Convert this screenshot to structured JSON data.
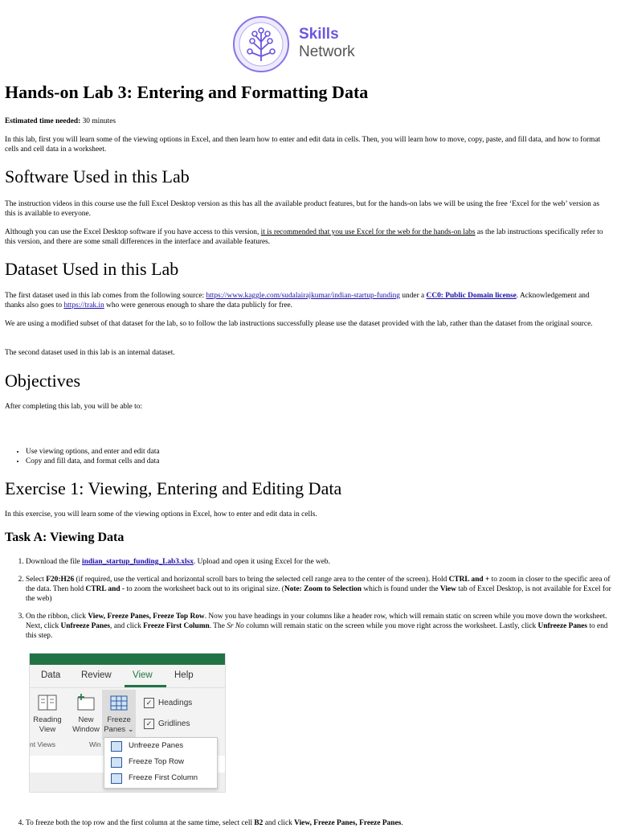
{
  "header": {
    "logo_word1": "Skills",
    "logo_word2": "Network"
  },
  "title": "Hands-on Lab 3: Entering and Formatting Data",
  "estimated": {
    "label": "Estimated time needed:",
    "value": "30 minutes"
  },
  "intro": "In this lab, first you will learn some of the viewing options in Excel, and then learn how to enter and edit data in cells. Then, you will learn how to move, copy, paste, and fill data, and how to format cells and cell data in a worksheet.",
  "software": {
    "heading": "Software Used in this Lab",
    "p1": "The instruction videos in this course use the full Excel Desktop version as this has all the available product features, but for the hands-on labs we will be using the free ‘Excel for the web’ version as this is available to everyone.",
    "p2_a": "Although you can use the Excel Desktop software if you have access to this version, ",
    "p2_u": "it is recommended that you use Excel for the web for the hands-on labs",
    "p2_b": " as the lab instructions specifically refer to this version, and there are some small differences in the interface and available features."
  },
  "dataset": {
    "heading": "Dataset Used in this Lab",
    "p1_a": "The first dataset used in this lab comes from the following source: ",
    "link1": "https://www.kaggle.com/sudalairajkumar/indian-startup-funding",
    "p1_b": " under a ",
    "link2": "CC0: Public Domain license",
    "p1_c": ". Acknowledgement and thanks also goes to ",
    "link3": "https://trak.in",
    "p1_d": " who were generous enough to share the data publicly for free.",
    "p2": "We are using a modified subset of that dataset for the lab, so to follow the lab instructions successfully please use the dataset provided with the lab, rather than the dataset from the original source.",
    "p3": "The second dataset used in this lab is an internal dataset."
  },
  "objectives": {
    "heading": "Objectives",
    "intro": "After completing this lab, you will be able to:",
    "items": [
      "Use viewing options, and enter and edit data",
      "Copy and fill data, and format cells and data"
    ]
  },
  "exercise1": {
    "heading": "Exercise 1: Viewing, Entering and Editing Data",
    "intro": "In this exercise, you will learn some of the viewing options in Excel, how to enter and edit data in cells.",
    "taskA": "Task A: Viewing Data",
    "step1_a": "Download the file ",
    "step1_link": "indian_startup_funding_Lab3.xlsx",
    "step1_b": ". Upload and open it using Excel for the web.",
    "step2": {
      "a": "Select ",
      "range": "F20:H26",
      "b": " (if required, use the vertical and horizontal scroll bars to bring the selected cell range area to the center of the screen). Hold ",
      "k1": "CTRL and +",
      "c": " to zoom in closer to the specific area of the data. Then hold ",
      "k2": "CTRL and -",
      "d": " to zoom the worksheet back out to its original size. (",
      "note": "Note: Zoom to Selection",
      "e": " which is found under the ",
      "view": "View",
      "f": " tab of Excel Desktop, is not available for Excel for the web)"
    },
    "step3": {
      "a": "On the ribbon, click ",
      "b1": "View, Freeze Panes, Freeze Top Row",
      "b": ". Now you have headings in your columns like a header row, which will remain static on screen while you move down the worksheet. Next, click ",
      "b2": "Unfreeze Panes",
      "c": ", and click ",
      "b3": "Freeze First Column",
      "d": ". The ",
      "i1": "Sr No",
      "e": " column will remain static on the screen while you move right across the worksheet. Lastly, click ",
      "b4": "Unfreeze Panes",
      "f": " to end this step."
    },
    "step4": {
      "a": "To freeze both the top row and the first column at the same time, select cell ",
      "b1": "B2",
      "b": " and click ",
      "b2": "View, Freeze Panes, Freeze Panes",
      "c": "."
    }
  },
  "excel_ui": {
    "tabs": [
      "Data",
      "Review",
      "View",
      "Help"
    ],
    "active_tab": "View",
    "reading_view": "Reading View",
    "new_window": "New Window",
    "freeze_panes": "Freeze Panes",
    "headings": "Headings",
    "gridlines": "Gridlines",
    "group_views": "nt Views",
    "group_window": "Win",
    "dropdown": [
      "Unfreeze Panes",
      "Freeze Top Row",
      "Freeze First Column"
    ],
    "accent": "#217346"
  }
}
